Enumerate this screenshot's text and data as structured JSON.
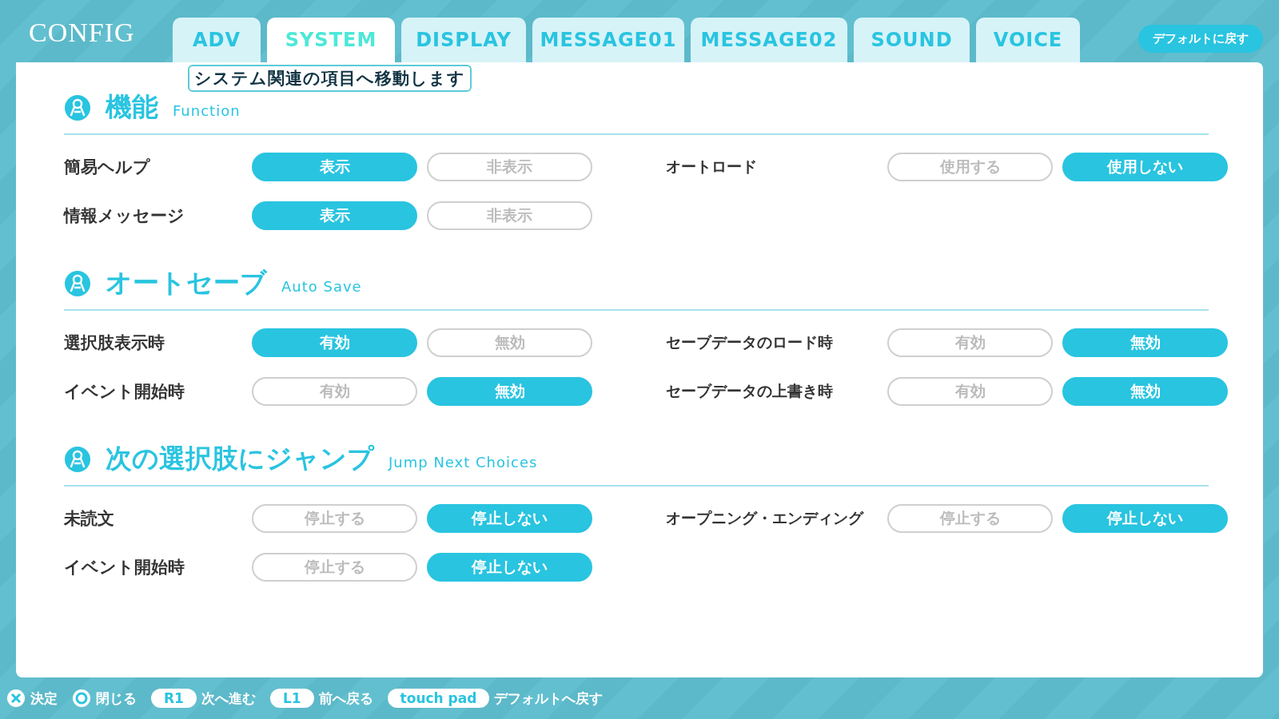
{
  "title": "CONFIG",
  "tabs": [
    {
      "label": "ADV",
      "selected": false
    },
    {
      "label": "SYSTEM",
      "selected": true
    },
    {
      "label": "DISPLAY",
      "selected": false
    },
    {
      "label": "MESSAGE01",
      "selected": false
    },
    {
      "label": "MESSAGE02",
      "selected": false
    },
    {
      "label": "SOUND",
      "selected": false
    },
    {
      "label": "VOICE",
      "selected": false
    }
  ],
  "reset_button": "デフォルトに戻す",
  "tooltip": "システム関連の項目へ移動します",
  "sections": [
    {
      "title": "機能",
      "subtitle": "Function",
      "left": [
        {
          "label": "簡易ヘルプ",
          "options": [
            {
              "label": "表示",
              "selected": true
            },
            {
              "label": "非表示",
              "selected": false
            }
          ]
        },
        {
          "label": "情報メッセージ",
          "options": [
            {
              "label": "表示",
              "selected": true
            },
            {
              "label": "非表示",
              "selected": false
            }
          ]
        }
      ],
      "right": [
        {
          "label": "オートロード",
          "options": [
            {
              "label": "使用する",
              "selected": false
            },
            {
              "label": "使用しない",
              "selected": true
            }
          ]
        }
      ]
    },
    {
      "title": "オートセーブ",
      "subtitle": "Auto Save",
      "left": [
        {
          "label": "選択肢表示時",
          "options": [
            {
              "label": "有効",
              "selected": true
            },
            {
              "label": "無効",
              "selected": false
            }
          ]
        },
        {
          "label": "イベント開始時",
          "options": [
            {
              "label": "有効",
              "selected": false
            },
            {
              "label": "無効",
              "selected": true
            }
          ]
        }
      ],
      "right": [
        {
          "label": "セーブデータのロード時",
          "options": [
            {
              "label": "有効",
              "selected": false
            },
            {
              "label": "無効",
              "selected": true
            }
          ]
        },
        {
          "label": "セーブデータの上書き時",
          "options": [
            {
              "label": "有効",
              "selected": false
            },
            {
              "label": "無効",
              "selected": true
            }
          ]
        }
      ]
    },
    {
      "title": "次の選択肢にジャンプ",
      "subtitle": "Jump Next Choices",
      "left": [
        {
          "label": "未読文",
          "options": [
            {
              "label": "停止する",
              "selected": false
            },
            {
              "label": "停止しない",
              "selected": true
            }
          ]
        },
        {
          "label": "イベント開始時",
          "options": [
            {
              "label": "停止する",
              "selected": false
            },
            {
              "label": "停止しない",
              "selected": true
            }
          ]
        }
      ],
      "right": [
        {
          "label": "オープニング・エンディング",
          "options": [
            {
              "label": "停止する",
              "selected": false
            },
            {
              "label": "停止しない",
              "selected": true
            }
          ]
        }
      ]
    }
  ],
  "hints": [
    {
      "kind": "cross",
      "label": "決定"
    },
    {
      "kind": "circle",
      "label": "閉じる"
    },
    {
      "kind": "key",
      "key": "R1",
      "label": "次へ進む"
    },
    {
      "kind": "key",
      "key": "L1",
      "label": "前へ戻る"
    },
    {
      "kind": "key",
      "key": "touch pad",
      "label": "デフォルトへ戻す"
    }
  ]
}
